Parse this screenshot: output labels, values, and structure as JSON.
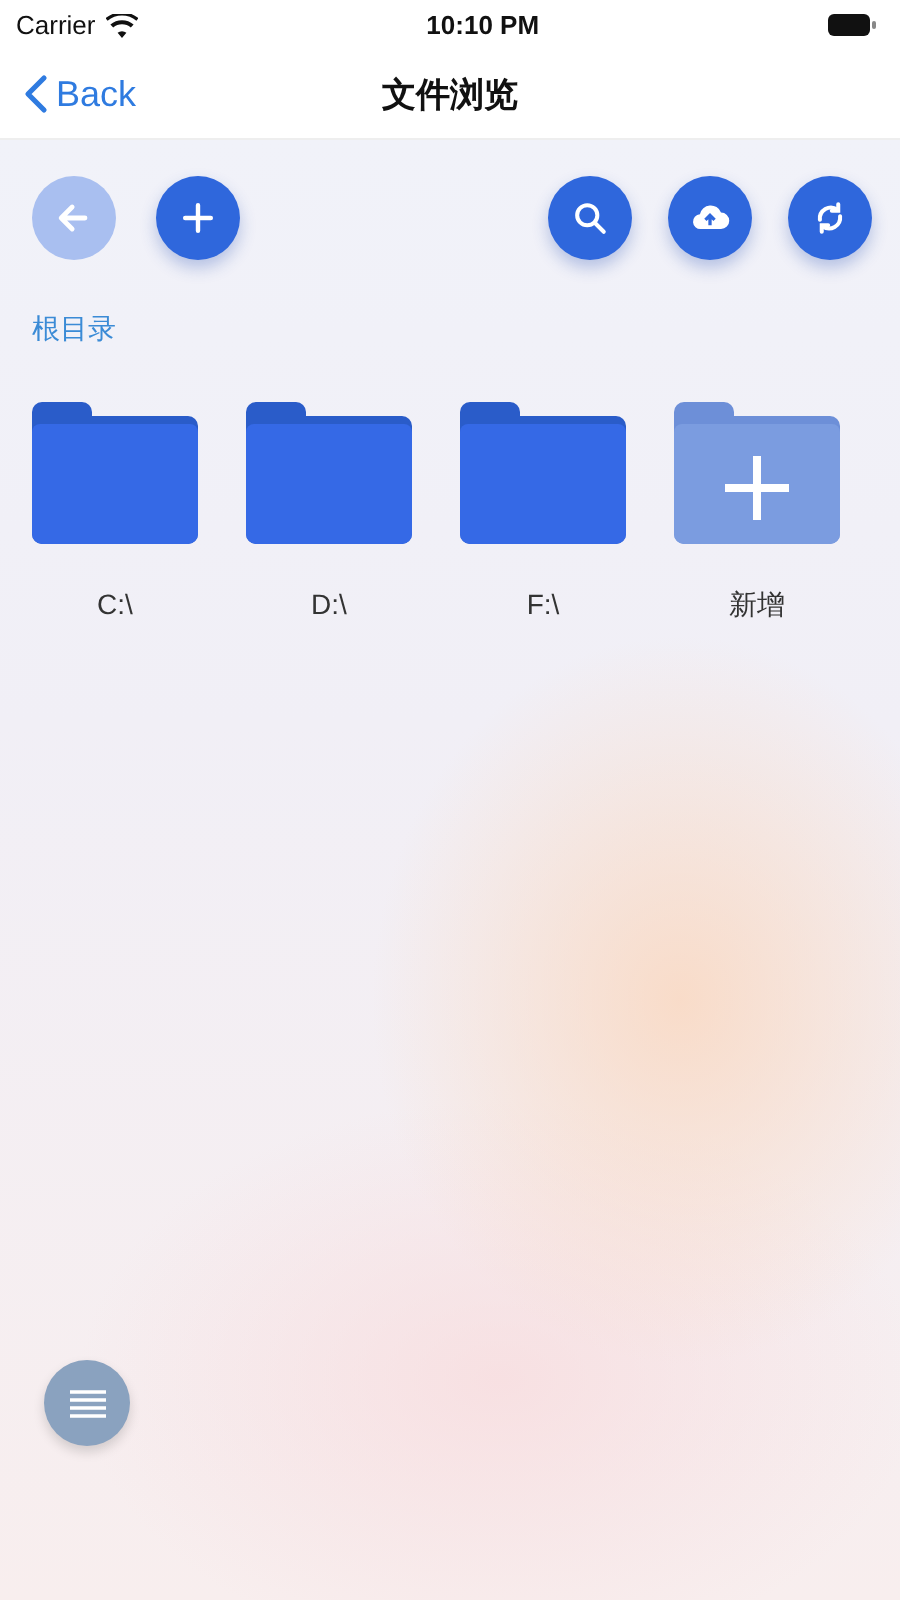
{
  "status_bar": {
    "carrier": "Carrier",
    "time": "10:10 PM"
  },
  "nav": {
    "back": "Back",
    "title": "文件浏览"
  },
  "toolbar": {
    "left": [
      {
        "kind": "back",
        "disabled": true
      },
      {
        "kind": "add",
        "disabled": false
      }
    ],
    "right": [
      {
        "kind": "search",
        "disabled": false
      },
      {
        "kind": "upload",
        "disabled": false
      },
      {
        "kind": "refresh",
        "disabled": false
      }
    ]
  },
  "breadcrumb": "根目录",
  "items": [
    {
      "kind": "folder",
      "label": "C:\\"
    },
    {
      "kind": "folder",
      "label": "D:\\"
    },
    {
      "kind": "folder",
      "label": "F:\\"
    },
    {
      "kind": "add",
      "label": "新增"
    }
  ]
}
